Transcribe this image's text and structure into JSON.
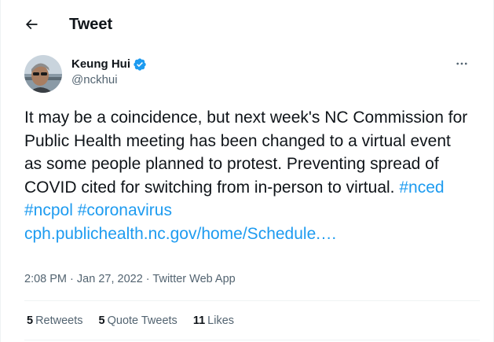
{
  "header": {
    "title": "Tweet"
  },
  "author": {
    "name": "Keung Hui",
    "handle": "@nckhui",
    "verified": true
  },
  "tweet": {
    "text_part1": "It may be a coincidence, but next week's NC Commission for Public Health meeting has been changed to a virtual event as some people planned to protest. Preventing spread of COVID cited for switching from in-person to virtual.",
    "hashtag1": "#nced",
    "hashtag2": "#ncpol",
    "hashtag3": "#coronavirus",
    "link": "cph.publichealth.nc.gov/home/Schedule.…"
  },
  "meta": {
    "time": "2:08 PM",
    "separator": "·",
    "date": "Jan 27, 2022",
    "source": "Twitter Web App"
  },
  "stats": {
    "retweets_count": "5",
    "retweets_label": "Retweets",
    "quote_count": "5",
    "quote_label": "Quote Tweets",
    "likes_count": "11",
    "likes_label": "Likes"
  },
  "colors": {
    "link": "#1d9bf0",
    "text": "#0f1419",
    "secondary": "#536471",
    "verified_badge": "#1d9bf0"
  },
  "icons": {
    "back": "arrow-left-icon",
    "verified": "verified-badge-icon",
    "more": "more-horizontal-icon"
  }
}
